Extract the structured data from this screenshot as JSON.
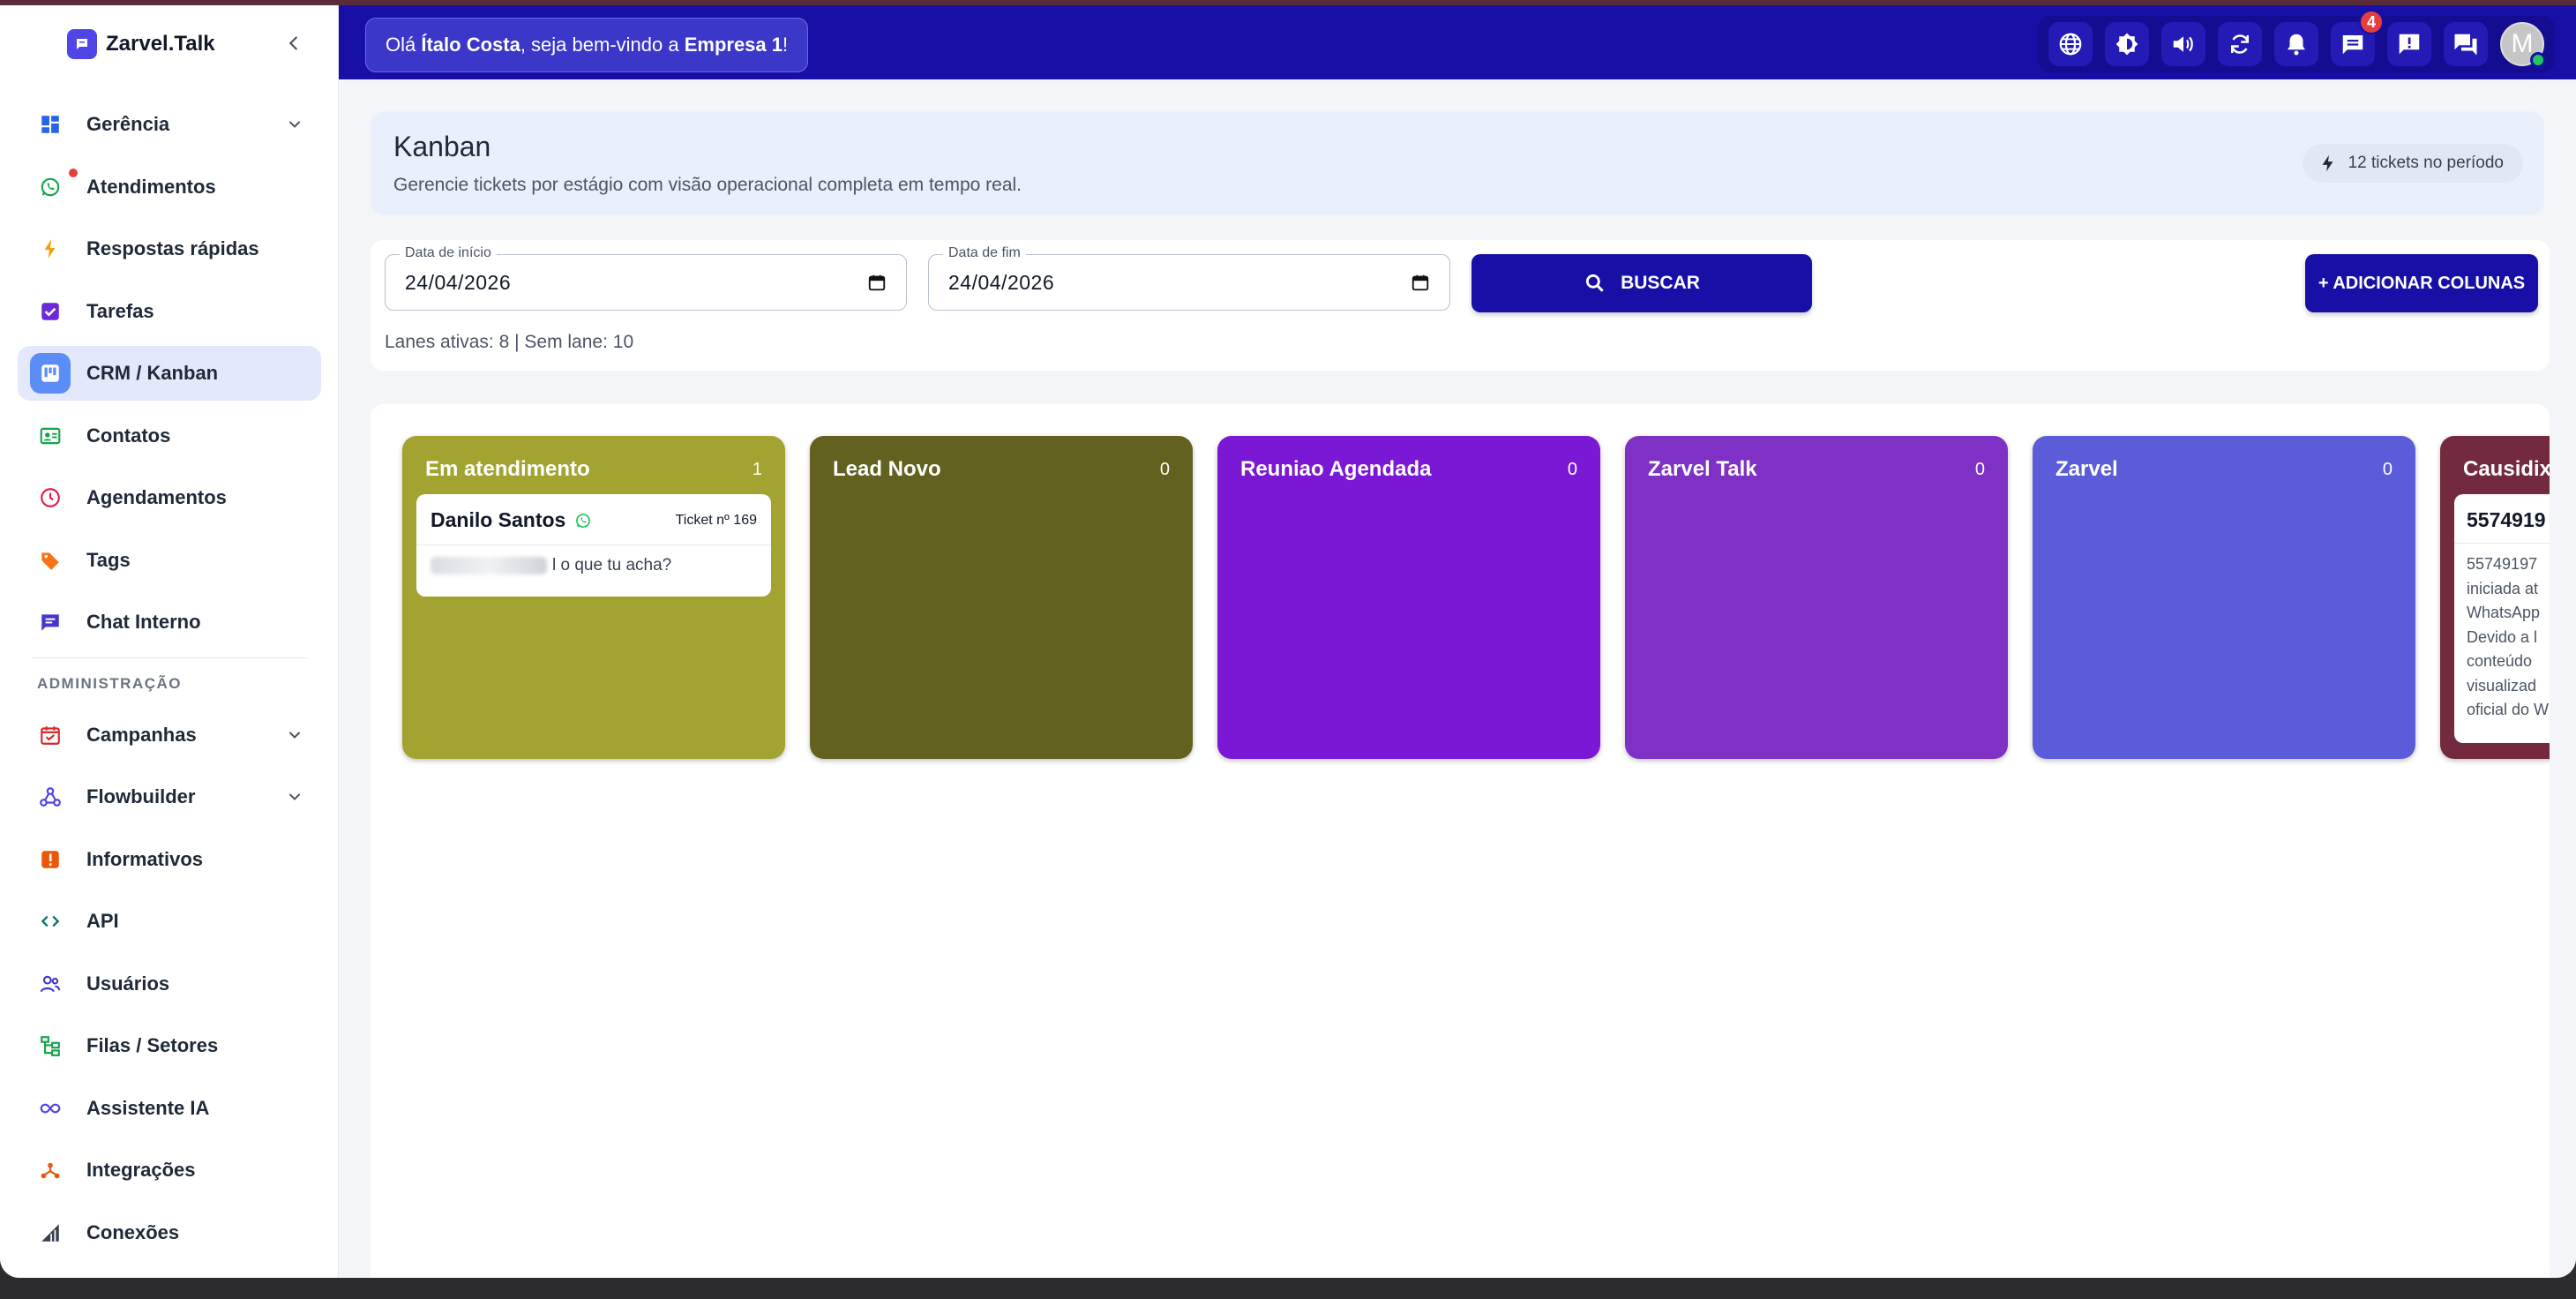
{
  "app": {
    "name": "Zarvel.Talk"
  },
  "header": {
    "welcome_prefix": "Olá ",
    "user_name": "Ítalo Costa",
    "welcome_middle": ", seja bem-vindo a ",
    "company": "Empresa 1",
    "welcome_suffix": "!",
    "icons": [
      "globe-icon",
      "brightness-icon",
      "volume-icon",
      "refresh-icon",
      "bell-icon",
      "chat-icon",
      "alert-icon",
      "forum-icon"
    ],
    "chat_badge": "4",
    "avatar_letter": "M"
  },
  "sidebar": {
    "items": [
      {
        "label": "Gerência",
        "icon": "dashboard-icon",
        "color": "#2563eb",
        "has_chevron": true
      },
      {
        "label": "Atendimentos",
        "icon": "whatsapp-icon",
        "color": "#16a34a",
        "has_dot": true
      },
      {
        "label": "Respostas rápidas",
        "icon": "bolt-icon",
        "color": "#f59e0b"
      },
      {
        "label": "Tarefas",
        "icon": "checkbox-icon",
        "color": "#6d28d9"
      },
      {
        "label": "CRM / Kanban",
        "icon": "kanban-icon",
        "color": "#3b82f6",
        "active": true
      },
      {
        "label": "Contatos",
        "icon": "contact-card-icon",
        "color": "#16a34a"
      },
      {
        "label": "Agendamentos",
        "icon": "clock-icon",
        "color": "#e11d48"
      },
      {
        "label": "Tags",
        "icon": "tag-icon",
        "color": "#f97316"
      },
      {
        "label": "Chat Interno",
        "icon": "chat-bubble-icon",
        "color": "#4338ca"
      }
    ],
    "section_label": "ADMINISTRAÇÃO",
    "admin_items": [
      {
        "label": "Campanhas",
        "icon": "calendar-check-icon",
        "color": "#dc2626",
        "has_chevron": true
      },
      {
        "label": "Flowbuilder",
        "icon": "webhook-icon",
        "color": "#4f46e5",
        "has_chevron": true
      },
      {
        "label": "Informativos",
        "icon": "announcement-icon",
        "color": "#ea580c"
      },
      {
        "label": "API",
        "icon": "code-icon",
        "color": "#0f766e"
      },
      {
        "label": "Usuários",
        "icon": "users-icon",
        "color": "#4338ca"
      },
      {
        "label": "Filas / Setores",
        "icon": "tree-icon",
        "color": "#16a34a"
      },
      {
        "label": "Assistente IA",
        "icon": "infinity-icon",
        "color": "#4f46e5"
      },
      {
        "label": "Integrações",
        "icon": "integration-icon",
        "color": "#ea580c"
      },
      {
        "label": "Conexões",
        "icon": "signal-icon",
        "color": "#374151"
      }
    ]
  },
  "kanban": {
    "title": "Kanban",
    "subtitle": "Gerencie tickets por estágio com visão operacional completa em tempo real.",
    "count_label": "12 tickets no período",
    "filters": {
      "start_label": "Data de início",
      "start_value": "24/04/2026",
      "end_label": "Data de fim",
      "end_value": "24/04/2026",
      "search_label": "BUSCAR",
      "add_columns_label": "+ ADICIONAR COLUNAS",
      "lanes_info": "Lanes ativas: 8 | Sem lane: 10"
    },
    "lanes": [
      {
        "title": "Em atendimento",
        "count": "1",
        "color": "#a3a332",
        "cards": [
          {
            "name": "Danilo Santos",
            "channel": "whatsapp-icon",
            "ticket": "Ticket nº 169",
            "message": "l o que tu acha?"
          }
        ]
      },
      {
        "title": "Lead Novo",
        "count": "0",
        "color": "#62611f",
        "cards": []
      },
      {
        "title": "Reuniao Agendada",
        "count": "0",
        "color": "#7a18d6",
        "cards": []
      },
      {
        "title": "Zarvel Talk",
        "count": "0",
        "color": "#7e31c4",
        "cards": []
      },
      {
        "title": "Zarvel",
        "count": "0",
        "color": "#5b5cd9",
        "cards": []
      },
      {
        "title": "Causidix",
        "count": "",
        "color": "#742a3e",
        "cards": [
          {
            "name": "5574919",
            "message_lines": [
              "55749197",
              "iniciada at",
              "WhatsApp",
              "Devido a l",
              "conteúdo",
              "visualizad",
              "oficial do W"
            ]
          }
        ]
      }
    ]
  }
}
